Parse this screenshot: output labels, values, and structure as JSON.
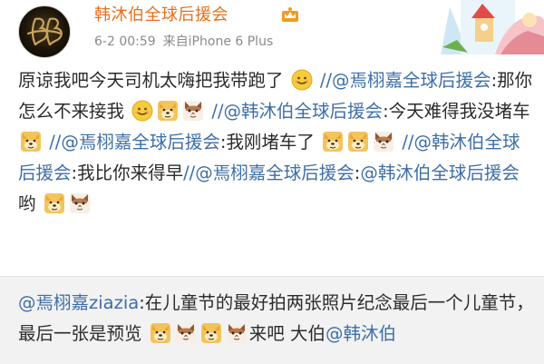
{
  "header": {
    "username": "韩沐伯全球后援会",
    "time": "6-2 00:59",
    "source": "来自iPhone 6 Plus",
    "badge_icon": "crown-vip-icon",
    "avatar_icon": "monogram-logo-avatar"
  },
  "post": {
    "t1": "原谅我吧今天司机太嗨把我带跑了",
    "m1": "//@焉栩嘉全球后援会",
    "t2": ":那你怎么不来接我",
    "m2": "//@韩沐伯全球后援会",
    "t3": ":今天难得我没堵车",
    "m3": "//@焉栩嘉全球后援会",
    "t4": ":我刚堵车了",
    "m4": "//@韩沐伯全球后援会",
    "t5": ":我比你来得早",
    "m5": "//@焉栩嘉全球后援会",
    "t6": ":",
    "m6": "@韩沐伯全球后援会",
    "t7": " 哟"
  },
  "repost": {
    "author": "@焉栩嘉ziazia",
    "text": ":在儿童节的最好拍两张照片纪念最后一个儿童节，最后一张是预览",
    "tail": "来吧",
    "tail2": "大伯",
    "mention": "@韩沐伯"
  },
  "colors": {
    "username": "#e8701a",
    "mention": "#3e6ea8",
    "meta": "#8a8a8a",
    "repost_bg": "#f2f2f2"
  },
  "emoji": {
    "smile": "smile-emoji-icon",
    "doge": "doge-emoji-icon",
    "cat": "cat-emoji-icon"
  }
}
